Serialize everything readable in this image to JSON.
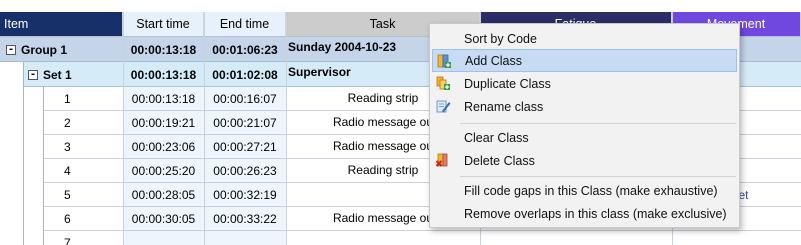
{
  "columns": {
    "item": "Item",
    "start_time": "Start time",
    "end_time": "End time",
    "task": "Task",
    "fatigue": "Fatigue",
    "movement": "Movement"
  },
  "colors": {
    "item_header": "#17306a",
    "fatigue_header": "#2c2c66",
    "movement_header": "#7048e0",
    "group_row": "#c4d5ea",
    "set_row": "#d5ecf8",
    "menu_highlight": "#c7dcf4"
  },
  "group": {
    "expander": "-",
    "name": "Group  1",
    "start": "00:00:13:18",
    "end": "00:01:06:23",
    "task": "Sunday 2004-10-23"
  },
  "set": {
    "expander": "-",
    "name": "Set  1",
    "start": "00:00:13:18",
    "end": "00:01:02:08",
    "task": "Supervisor"
  },
  "rows": [
    {
      "item": "1",
      "start": "00:00:13:18",
      "end": "00:00:16:07",
      "task": "Reading strip",
      "movement": ""
    },
    {
      "item": "2",
      "start": "00:00:19:21",
      "end": "00:00:21:07",
      "task": "Radio message ou",
      "movement": ""
    },
    {
      "item": "3",
      "start": "00:00:23:06",
      "end": "00:00:27:21",
      "task": "Radio message ou",
      "movement": ""
    },
    {
      "item": "4",
      "start": "00:00:25:20",
      "end": "00:00:26:23",
      "task": "Reading strip",
      "movement": ""
    },
    {
      "item": "5",
      "start": "00:00:28:05",
      "end": "00:00:32:19",
      "task": "",
      "movement": "Feet"
    },
    {
      "item": "6",
      "start": "00:00:30:05",
      "end": "00:00:33:22",
      "task": "Radio message ou",
      "movement": ""
    },
    {
      "item": "7",
      "start": "",
      "end": "",
      "task": "",
      "movement": ""
    }
  ],
  "context_menu": {
    "items": [
      {
        "label": "Sort by Code",
        "icon": "none"
      },
      {
        "label": "Add Class",
        "icon": "add-class-icon"
      },
      {
        "label": "Duplicate Class",
        "icon": "duplicate-class-icon"
      },
      {
        "label": "Rename class",
        "icon": "rename-class-icon"
      },
      {
        "label": "Clear Class",
        "icon": "none"
      },
      {
        "label": "Delete Class",
        "icon": "delete-class-icon"
      },
      {
        "label": "Fill code gaps in this Class (make exhaustive)",
        "icon": "none"
      },
      {
        "label": "Remove overlaps in this class  (make exclusive)",
        "icon": "none"
      }
    ]
  }
}
